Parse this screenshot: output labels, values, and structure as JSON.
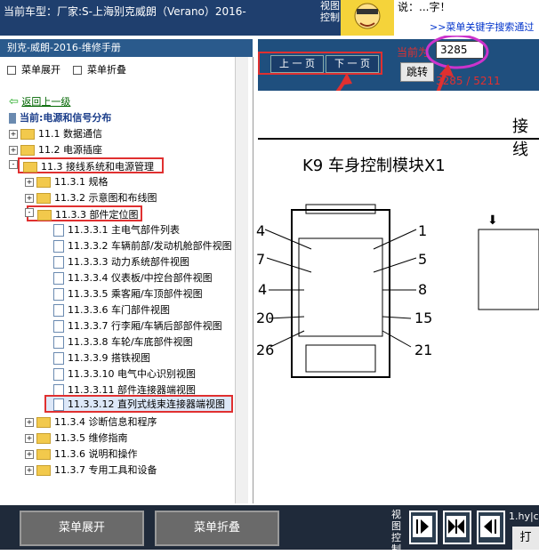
{
  "topbar": {
    "vehicle_label": "当前车型：厂家:S-上海别克威朗（Verano）2016-",
    "view_control": "视图控制",
    "ad_text": "说：...字！",
    "ad_link": ">>菜单关键字搜索通过"
  },
  "left_panel": {
    "title": "别克-威朗-2016-维修手册",
    "expand_label": "菜单展开",
    "collapse_label": "菜单折叠",
    "back_label": "返回上一级",
    "current_label": "当前:电源和信号分布",
    "tree": [
      {
        "label": "11.1 数据通信"
      },
      {
        "label": "11.2 电源插座"
      },
      {
        "label": "11.3 接线系统和电源管理"
      },
      {
        "label": "11.3.1 规格"
      },
      {
        "label": "11.3.2 示意图和布线图"
      },
      {
        "label": "11.3.3 部件定位图"
      },
      {
        "label": "11.3.3.1 主电气部件列表"
      },
      {
        "label": "11.3.3.2 车辆前部/发动机舱部件视图"
      },
      {
        "label": "11.3.3.3 动力系统部件视图"
      },
      {
        "label": "11.3.3.4 仪表板/中控台部件视图"
      },
      {
        "label": "11.3.3.5 乘客厢/车顶部件视图"
      },
      {
        "label": "11.3.3.6 车门部件视图"
      },
      {
        "label": "11.3.3.7 行李厢/车辆后部部件视图"
      },
      {
        "label": "11.3.3.8 车轮/车底部件视图"
      },
      {
        "label": "11.3.3.9 搭铁视图"
      },
      {
        "label": "11.3.3.10 电气中心识别视图"
      },
      {
        "label": "11.3.3.11 部件连接器端视图"
      },
      {
        "label": "11.3.3.12 直列式线束连接器端视图"
      },
      {
        "label": "11.3.4 诊断信息和程序"
      },
      {
        "label": "11.3.5 维修指南"
      },
      {
        "label": "11.3.6 说明和操作"
      },
      {
        "label": "11.3.7 专用工具和设备"
      }
    ]
  },
  "pager": {
    "prev_label": "上 一 页",
    "next_label": "下 一 页",
    "current_label": "当前为",
    "current_value": "3285",
    "jump_label": "跳转",
    "page_count": "3285 / 5211"
  },
  "document": {
    "header_text": "接线",
    "module_title": "K9 车身控制模块X1",
    "pins": [
      "4",
      "1",
      "7",
      "5",
      "4",
      "8",
      "20",
      "15",
      "26",
      "21"
    ]
  },
  "bottom": {
    "expand_label": "菜单展开",
    "collapse_label": "菜单折叠",
    "view_control": "视图控制",
    "filename": "1.hy|c",
    "print_label": "打"
  },
  "colors": {
    "highlight_box": "#e03030",
    "nav_dark": "#1f3f6e"
  }
}
